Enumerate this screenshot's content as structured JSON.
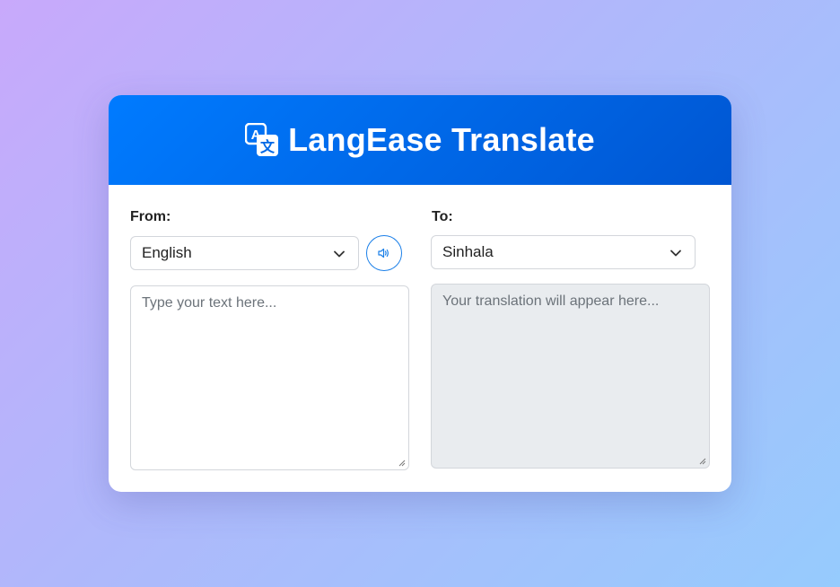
{
  "app": {
    "title": "LangEase Translate",
    "accent_color": "#007bff",
    "icon": "translate-icon"
  },
  "source": {
    "label": "From:",
    "language": "English",
    "speak_icon": "speaker-icon",
    "placeholder": "Type your text here..."
  },
  "target": {
    "label": "To:",
    "language": "Sinhala",
    "placeholder": "Your translation will appear here..."
  }
}
